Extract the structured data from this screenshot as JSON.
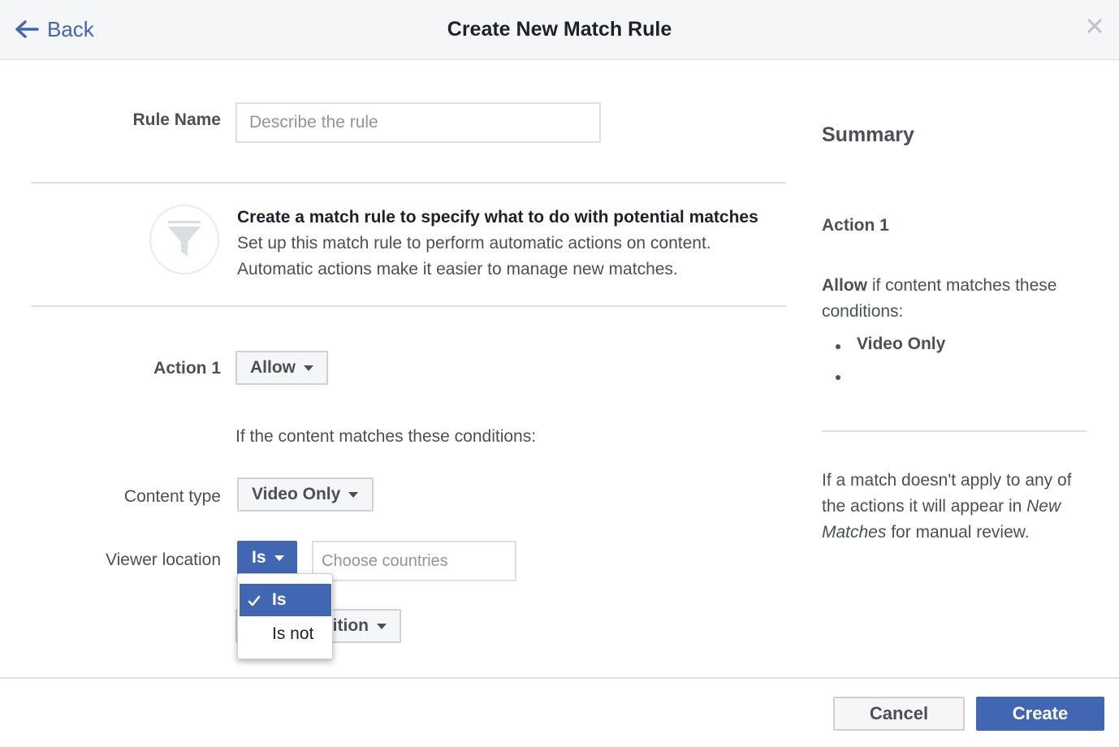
{
  "header": {
    "back_label": "Back",
    "title": "Create New Match Rule"
  },
  "rule_name": {
    "label": "Rule Name",
    "placeholder": "Describe the rule",
    "value": ""
  },
  "info": {
    "title": "Create a match rule to specify what to do with potential matches",
    "line1": "Set up this match rule to perform automatic actions on content.",
    "line2": "Automatic actions make it easier to manage new matches."
  },
  "action": {
    "label": "Action 1",
    "selected": "Allow",
    "conditions_intro": "If the content matches these conditions:"
  },
  "content_type": {
    "label": "Content type",
    "selected": "Video Only"
  },
  "viewer_location": {
    "label": "Viewer location",
    "operator": "Is",
    "countries_placeholder": "Choose countries",
    "options": [
      {
        "label": "Is",
        "selected": true
      },
      {
        "label": "Is not",
        "selected": false
      }
    ]
  },
  "add_condition": {
    "label_visible_part": "ition"
  },
  "summary": {
    "title": "Summary",
    "action_heading": "Action 1",
    "action_word": "Allow",
    "action_rest_line1": " if content matches these",
    "action_rest_line2": "conditions:",
    "bullets": [
      "Video Only",
      ""
    ],
    "footnote_line1": "If a match doesn't apply to any of",
    "footnote_line2_prefix": "the actions it will appear in ",
    "footnote_line2_em": "New",
    "footnote_line3_em": "Matches",
    "footnote_line3_rest": " for manual review."
  },
  "footer": {
    "cancel_label": "Cancel",
    "create_label": "Create"
  },
  "colors": {
    "accent": "#4267b2",
    "header_bg": "#f5f6f7",
    "border": "#dddfe2",
    "text": "#4b4f56"
  }
}
